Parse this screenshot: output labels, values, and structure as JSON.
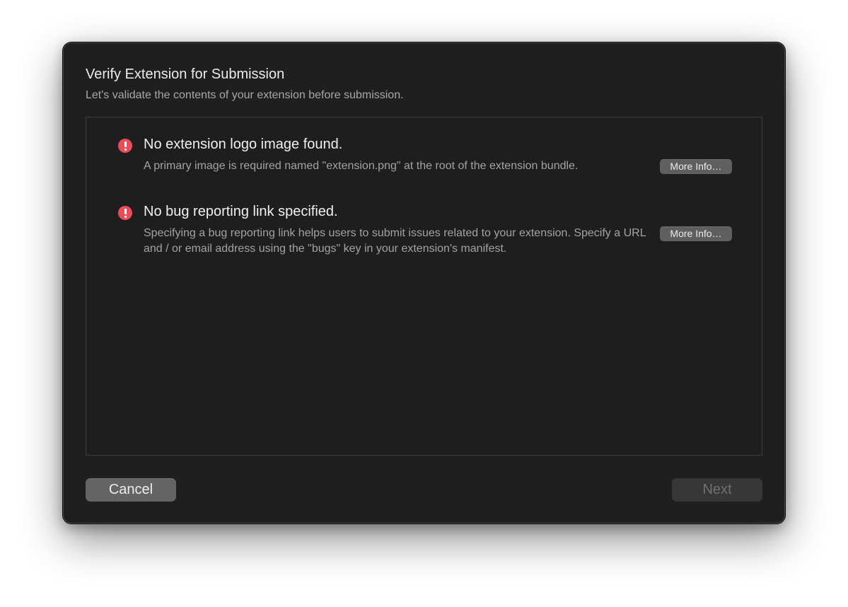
{
  "dialog": {
    "title": "Verify Extension for Submission",
    "subtitle": "Let's validate the contents of your extension before submission."
  },
  "issues": [
    {
      "severity": "error",
      "icon": "error-icon",
      "title": "No extension logo image found.",
      "description": "A primary image is required named \"extension.png\" at the root of the extension bundle.",
      "button_label": "More Info…"
    },
    {
      "severity": "error",
      "icon": "error-icon",
      "title": "No bug reporting link specified.",
      "description": "Specifying a bug reporting link helps users to submit issues related to your extension. Specify a URL and / or email address using the \"bugs\" key in your extension's manifest.",
      "button_label": "More Info…"
    }
  ],
  "footer": {
    "cancel_label": "Cancel",
    "next_label": "Next",
    "next_enabled": false
  },
  "colors": {
    "window_background": "#1f1f1f",
    "error": "#ec4b57",
    "button": "#646464",
    "button_disabled": "#373737"
  }
}
